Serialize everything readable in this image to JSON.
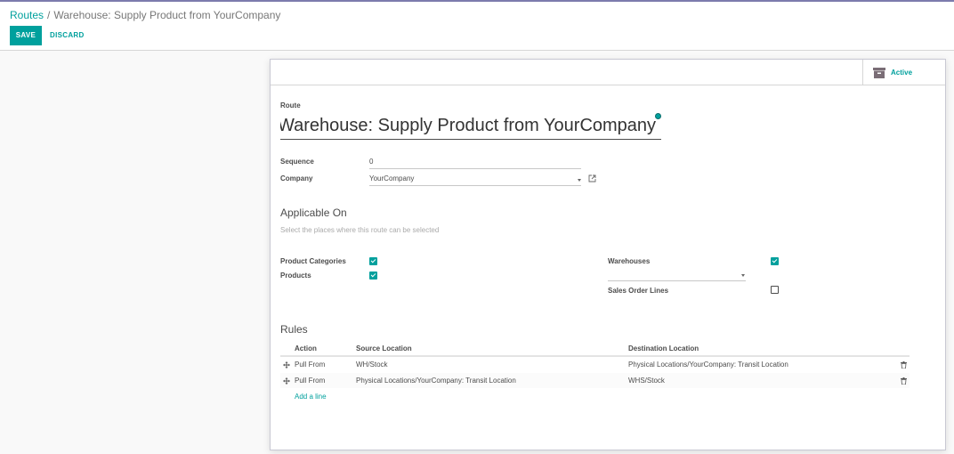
{
  "breadcrumb": {
    "parent": "Routes",
    "separator": "/",
    "current": "Warehouse: Supply Product from YourCompany"
  },
  "toolbar": {
    "save_label": "SAVE",
    "discard_label": "DISCARD"
  },
  "button_box": {
    "active_label": "Active",
    "active_icon": "archive-icon"
  },
  "form": {
    "route_label": "Route",
    "route_name": "Warehouse: Supply Product from YourCompany",
    "sequence_label": "Sequence",
    "sequence_value": "0",
    "company_label": "Company",
    "company_value": "YourCompany"
  },
  "applicable_on": {
    "title": "Applicable On",
    "help": "Select the places where this route can be selected",
    "product_categories_label": "Product Categories",
    "product_categories_checked": true,
    "products_label": "Products",
    "products_checked": true,
    "warehouses_label": "Warehouses",
    "warehouses_checked": true,
    "warehouses_value": "",
    "sales_order_lines_label": "Sales Order Lines",
    "sales_order_lines_checked": false
  },
  "rules": {
    "title": "Rules",
    "columns": [
      "Action",
      "Source Location",
      "Destination Location"
    ],
    "rows": [
      {
        "action": "Pull From",
        "source": "WH/Stock",
        "destination": "Physical Locations/YourCompany: Transit Location"
      },
      {
        "action": "Pull From",
        "source": "Physical Locations/YourCompany: Transit Location",
        "destination": "WHS/Stock"
      }
    ],
    "add_line_label": "Add a line"
  },
  "colors": {
    "primary": "#00a09d",
    "top_bar": "#7c7bad"
  }
}
